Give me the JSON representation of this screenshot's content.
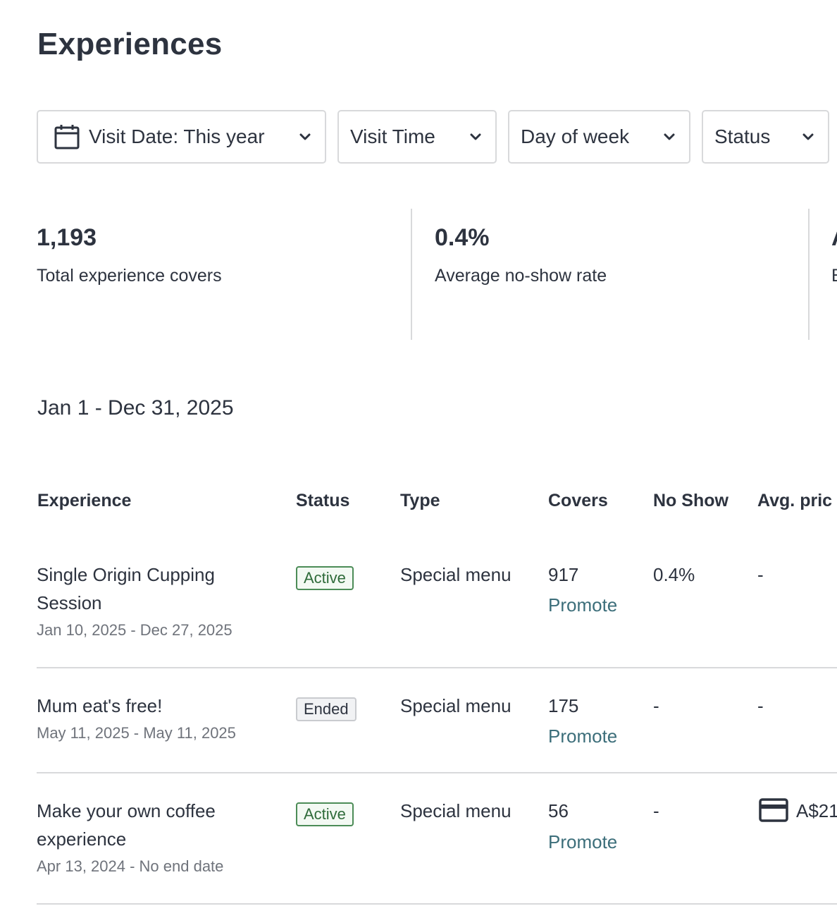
{
  "page": {
    "title": "Experiences"
  },
  "filters": [
    {
      "label": "Visit Date: This year",
      "icon": "calendar-icon"
    },
    {
      "label": "Visit Time"
    },
    {
      "label": "Day of week"
    },
    {
      "label": "Status"
    }
  ],
  "stats": [
    {
      "value": "1,193",
      "caption": "Total experience covers"
    },
    {
      "value": "0.4%",
      "caption": "Average no-show rate"
    },
    {
      "value": "A",
      "caption": "E"
    }
  ],
  "date_range": "Jan 1 - Dec 31, 2025",
  "table": {
    "headers": [
      "Experience",
      "Status",
      "Type",
      "Covers",
      "No Show",
      "Avg. pric"
    ],
    "rows": [
      {
        "name_line1": "Single Origin Cupping",
        "name_line2": "Session",
        "dates": "Jan 10, 2025 - Dec 27, 2025",
        "status": "Active",
        "type": "Special menu",
        "covers": "917",
        "promote": "Promote",
        "no_show": "0.4%",
        "avg_price": "-"
      },
      {
        "name_line1": "Mum eat's free!",
        "dates": "May 11, 2025 - May 11, 2025",
        "status": "Ended",
        "type": "Special menu",
        "covers": "175",
        "promote": "Promote",
        "no_show": "-",
        "avg_price": "-"
      },
      {
        "name_line1": "Make your own coffee",
        "name_line2": "experience",
        "dates": "Apr 13, 2024 - No end date",
        "status": "Active",
        "type": "Special menu",
        "covers": "56",
        "promote": "Promote",
        "no_show": "-",
        "avg_price": "A$21",
        "avg_price_icon": "credit-card-icon"
      }
    ]
  }
}
